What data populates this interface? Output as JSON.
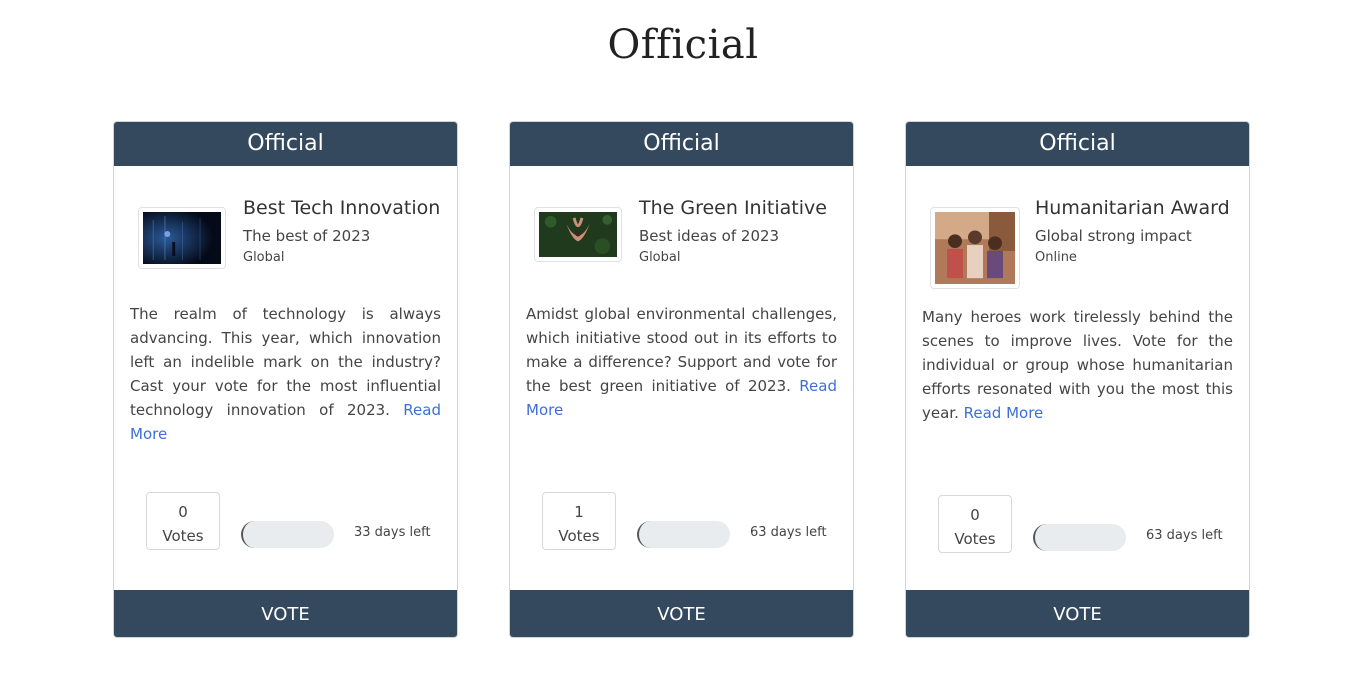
{
  "page": {
    "title": "Official"
  },
  "colors": {
    "header_bg": "#34495e",
    "link": "#3d6fd6",
    "progress_track": "#e9ecef"
  },
  "cards": [
    {
      "header": "Official",
      "image_icon": "night-forest-light-image",
      "image_colors": [
        "#0b1530",
        "#1d3a66",
        "#0a0f1f"
      ],
      "name": "Best Tech Innovation",
      "subtitle": "The best of 2023",
      "scope": "Global",
      "description": "The realm of technology is always advancing. This year, which innovation left an indelible mark on the industry? Cast your vote for the most influential technology innovation of 2023.",
      "read_more": "Read More",
      "votes_count": "0",
      "votes_label": "Votes",
      "progress": 0,
      "days_left": "33 days left",
      "vote_button": "VOTE"
    },
    {
      "header": "Official",
      "image_icon": "hands-holding-seedling-image",
      "image_colors": [
        "#1f3a1c",
        "#2f5a2a",
        "#c98f78"
      ],
      "name": "The Green Initiative",
      "subtitle": "Best ideas of 2023",
      "scope": "Global",
      "description": "Amidst global environmental challenges, which initiative stood out in its efforts to make a difference? Support and vote for the best green initiative of 2023.",
      "read_more": "Read More",
      "votes_count": "1",
      "votes_label": "Votes",
      "progress": 0,
      "days_left": "63 days left",
      "vote_button": "VOTE"
    },
    {
      "header": "Official",
      "image_icon": "group-of-children-image",
      "image_colors": [
        "#8a5a3c",
        "#c9977a",
        "#5a3a2a"
      ],
      "name": "Humanitarian Award",
      "subtitle": "Global strong impact",
      "scope": "Online",
      "description": "Many heroes work tirelessly behind the scenes to improve lives. Vote for the individual or group whose humanitarian efforts resonated with you the most this year.",
      "read_more": "Read More",
      "votes_count": "0",
      "votes_label": "Votes",
      "progress": 0,
      "days_left": "63 days left",
      "vote_button": "VOTE"
    }
  ]
}
